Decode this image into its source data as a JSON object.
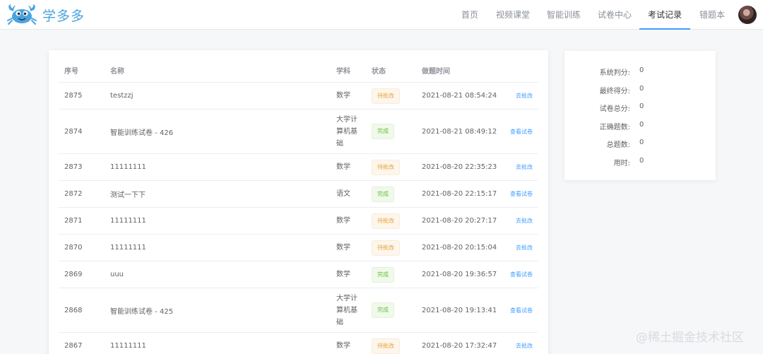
{
  "brand": {
    "name": "学多多"
  },
  "nav": [
    "首页",
    "视频课堂",
    "智能训练",
    "试卷中心",
    "考试记录",
    "错题本"
  ],
  "nav_active": "考试记录",
  "table": {
    "headers": [
      "序号",
      "名称",
      "学科",
      "状态",
      "做题时间"
    ],
    "rows": [
      {
        "id": "2875",
        "name": "testzzj",
        "subject": "数学",
        "status": "待批改",
        "time": "2021-08-21 08:54:24",
        "action": "去批改"
      },
      {
        "id": "2874",
        "name": "智能训练试卷 - 426",
        "subject": "大学计算机基础",
        "subject_lines": [
          "大学计",
          "算机基",
          "础"
        ],
        "status": "完成",
        "time": "2021-08-21 08:49:12",
        "action": "查看试卷"
      },
      {
        "id": "2873",
        "name": "11111111",
        "subject": "数学",
        "status": "待批改",
        "time": "2021-08-20 22:35:23",
        "action": "去批改"
      },
      {
        "id": "2872",
        "name": "测试一下下",
        "subject": "语文",
        "status": "完成",
        "time": "2021-08-20 22:15:17",
        "action": "查看试卷"
      },
      {
        "id": "2871",
        "name": "11111111",
        "subject": "数学",
        "status": "待批改",
        "time": "2021-08-20 20:27:17",
        "action": "去批改"
      },
      {
        "id": "2870",
        "name": "11111111",
        "subject": "数学",
        "status": "待批改",
        "time": "2021-08-20 20:15:04",
        "action": "去批改"
      },
      {
        "id": "2869",
        "name": "uuu",
        "subject": "数学",
        "status": "完成",
        "time": "2021-08-20 19:36:57",
        "action": "查看试卷"
      },
      {
        "id": "2868",
        "name": "智能训练试卷 - 425",
        "subject": "大学计算机基础",
        "subject_lines": [
          "大学计",
          "算机基",
          "础"
        ],
        "status": "完成",
        "time": "2021-08-20 19:13:41",
        "action": "查看试卷"
      },
      {
        "id": "2867",
        "name": "11111111",
        "subject": "数学",
        "status": "待批改",
        "time": "2021-08-20 17:32:47",
        "action": "去批改"
      }
    ]
  },
  "stats": [
    {
      "label": "系统判分:",
      "value": "0"
    },
    {
      "label": "最终得分:",
      "value": "0"
    },
    {
      "label": "试卷总分:",
      "value": "0"
    },
    {
      "label": "正确题数:",
      "value": "0"
    },
    {
      "label": "总题数:",
      "value": "0"
    },
    {
      "label": "用时:",
      "value": "0"
    }
  ],
  "watermark": "@稀土掘金技术社区",
  "icons": {
    "logo": "crab-icon",
    "avatar": "user-avatar"
  },
  "colors": {
    "brand": "#4aa3df",
    "accent": "#409eff",
    "pending": "#e6a23c",
    "done": "#67c23a"
  }
}
